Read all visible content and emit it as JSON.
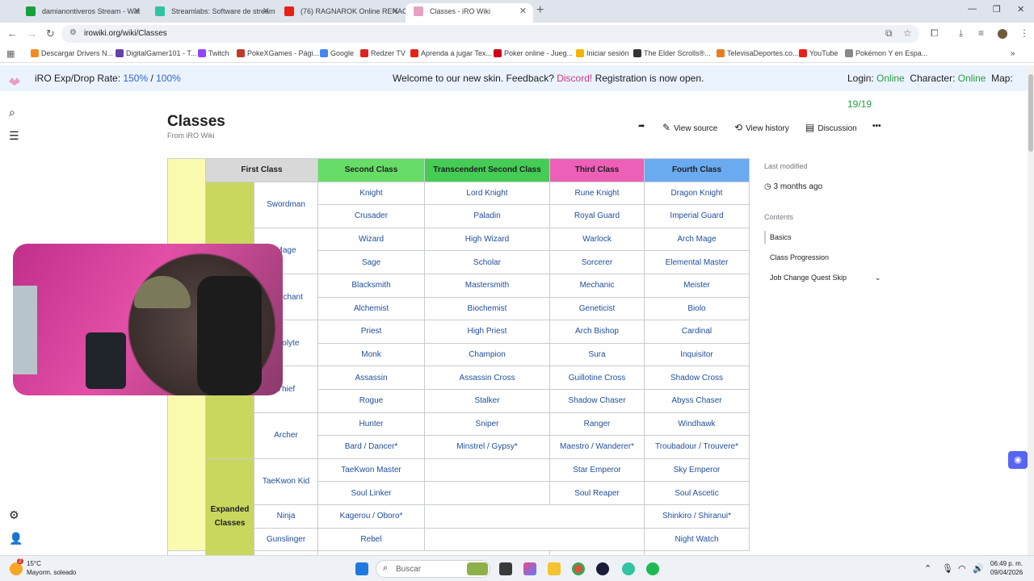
{
  "browser": {
    "tabs": [
      {
        "title": "damianontiveros Stream - Wat",
        "color": "#18a03b"
      },
      {
        "title": "Streamlabs: Software de stream",
        "color": "#31c3a2"
      },
      {
        "title": "(76) RAGNAROK Online RENAC",
        "color": "#e62117"
      },
      {
        "title": "Classes - iRO Wiki",
        "color": "#e8a0c0"
      }
    ],
    "url": "irowiki.org/wiki/Classes",
    "bookmarks": [
      "Descargar Drivers N...",
      "DigitalGamer101 - T...",
      "Twitch",
      "PokeXGames - Pági...",
      "Google",
      "Redzer TV",
      "Aprenda a jugar Tex...",
      "Poker online - Jueg...",
      "Iniciar sesión",
      "The Elder Scrolls®...",
      "TelevisaDeportes.co...",
      "YouTube",
      "Pokémon Y en Espa..."
    ]
  },
  "notice": {
    "rate_label": "iRO Exp/Drop Rate:",
    "rate_exp": "150%",
    "rate_sep": "/",
    "rate_drop": "100%",
    "welcome": "Welcome to our new skin. Feedback?",
    "discord": "Discord!",
    "registration": "Registration is now open.",
    "login_label": "Login:",
    "login_status": "Online",
    "char_label": "Character:",
    "char_status": "Online",
    "map_label": "Map:",
    "map_value": "19/19"
  },
  "page": {
    "title": "Classes",
    "subtitle": "From iRO Wiki",
    "view_source": "View source",
    "view_history": "View history",
    "discussion": "Discussion"
  },
  "sidebar": {
    "last_modified_label": "Last modified",
    "last_modified_value": "3 months ago",
    "contents_label": "Contents",
    "toc": [
      "Basics",
      "Class Progression",
      "Job Change Quest Skip"
    ]
  },
  "table": {
    "headers": [
      "First Class",
      "Second Class",
      "Transcendent Second Class",
      "Third Class",
      "Fourth Class"
    ],
    "group_label": "Expanded Classes",
    "rows": {
      "swordman": "Swordman",
      "mage": "Mage",
      "merchant": "Merchant",
      "acolyte": "Acolyte",
      "thief": "Thief",
      "archer": "Archer",
      "taekwon": "TaeKwon Kid",
      "ninja": "Ninja",
      "gunslinger": "Gunslinger"
    },
    "cells": {
      "knight": [
        "Knight",
        "Lord Knight",
        "Rune Knight",
        "Dragon Knight"
      ],
      "crusader": [
        "Crusader",
        "Paladin",
        "Royal Guard",
        "Imperial Guard"
      ],
      "wizard": [
        "Wizard",
        "High Wizard",
        "Warlock",
        "Arch Mage"
      ],
      "sage": [
        "Sage",
        "Scholar",
        "Sorcerer",
        "Elemental Master"
      ],
      "blacksmith": [
        "Blacksmith",
        "Mastersmith",
        "Mechanic",
        "Meister"
      ],
      "alchemist": [
        "Alchemist",
        "Biochemist",
        "Geneticist",
        "Biolo"
      ],
      "priest": [
        "Priest",
        "High Priest",
        "Arch Bishop",
        "Cardinal"
      ],
      "monk": [
        "Monk",
        "Champion",
        "Sura",
        "Inquisitor"
      ],
      "assassin": [
        "Assassin",
        "Assassin Cross",
        "Guillotine Cross",
        "Shadow Cross"
      ],
      "rogue": [
        "Rogue",
        "Stalker",
        "Shadow Chaser",
        "Abyss Chaser"
      ],
      "hunter": [
        "Hunter",
        "Sniper",
        "Ranger",
        "Windhawk"
      ],
      "bard": [
        "Bard / Dancer*",
        "Minstrel / Gypsy*",
        "Maestro / Wanderer*",
        "Troubadour / Trouvere*"
      ],
      "tkm": [
        "TaeKwon Master",
        "",
        "Star Emperor",
        "Sky Emperor"
      ],
      "soul": [
        "Soul Linker",
        "",
        "Soul Reaper",
        "Soul Ascetic"
      ],
      "ninja": [
        "Kagerou / Oboro*",
        "Shinkiro / Shiranui*"
      ],
      "gun": [
        "Rebel",
        "Night Watch"
      ]
    }
  },
  "taskbar": {
    "temp": "15°C",
    "weather": "Mayorm. soleado",
    "weather_badge": "2",
    "search": "Buscar",
    "time": "06:49 p. m.",
    "date": "09/04/2026"
  }
}
